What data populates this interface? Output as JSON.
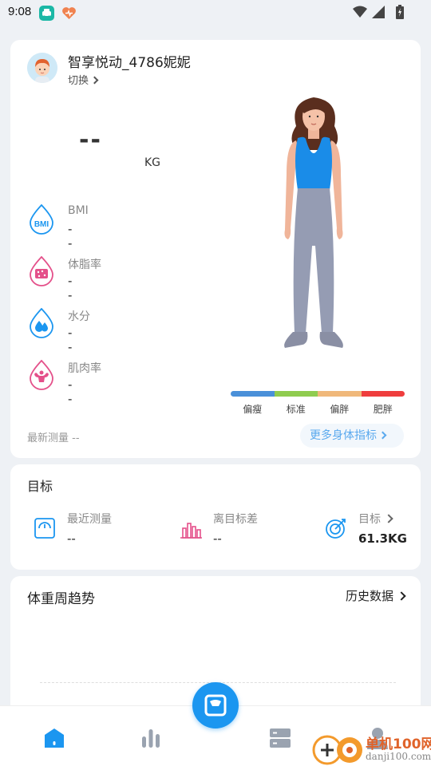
{
  "status_bar": {
    "time": "9:08"
  },
  "profile": {
    "username": "智享悦动_4786妮妮",
    "switch_label": "切换"
  },
  "weight": {
    "value": "--",
    "unit": "KG"
  },
  "metrics": [
    {
      "label": "BMI",
      "value": "--",
      "icon": "bmi-icon"
    },
    {
      "label": "体脂率",
      "value": "--",
      "icon": "body-fat-icon"
    },
    {
      "label": "水分",
      "value": "--",
      "icon": "water-icon"
    },
    {
      "label": "肌肉率",
      "value": "--",
      "icon": "muscle-icon"
    }
  ],
  "bmi_icon_text": "BMI",
  "body_scale": {
    "labels": [
      "偏瘦",
      "标准",
      "偏胖",
      "肥胖"
    ],
    "colors": [
      "#4a90d9",
      "#8fcc4f",
      "#f0b87a",
      "#ef3d3d"
    ]
  },
  "last_measure": "最新测量 --",
  "more_metrics_label": "更多身体指标",
  "goal": {
    "title": "目标",
    "items": [
      {
        "label": "最近测量",
        "value": "--"
      },
      {
        "label": "离目标差",
        "value": "--"
      },
      {
        "label": "目标",
        "value": "61.3KG"
      }
    ]
  },
  "trend": {
    "title": "体重周趋势",
    "history_label": "历史数据"
  },
  "watermark": {
    "text": "单机100网",
    "url": "danji100.com"
  },
  "colors": {
    "accent": "#1b96f0",
    "pink": "#e4508a"
  }
}
